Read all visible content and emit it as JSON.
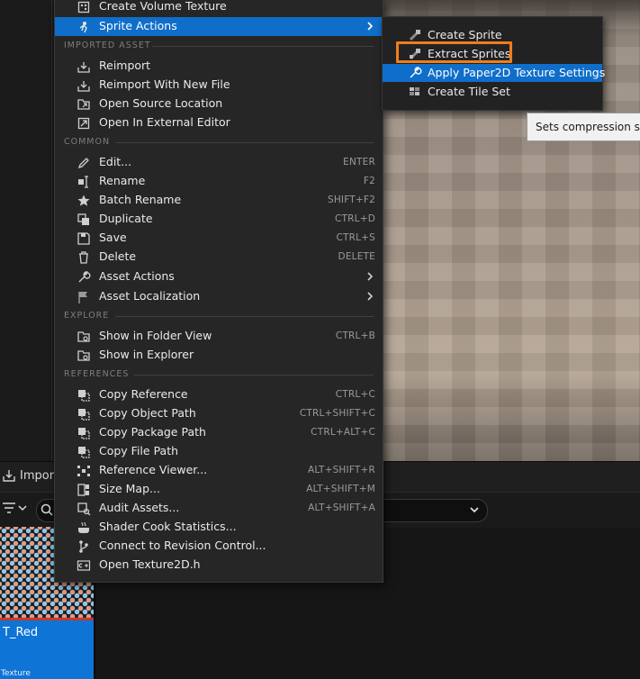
{
  "menu": {
    "top_items": [
      {
        "label": "Create Volume Texture",
        "icon": "volume-texture-icon"
      },
      {
        "label": "Sprite Actions",
        "icon": "sprite-actions-icon"
      }
    ],
    "sections": {
      "imported_asset": "IMPORTED ASSET",
      "common": "COMMON",
      "explore": "EXPLORE",
      "references": "REFERENCES"
    },
    "imported_asset_items": [
      {
        "label": "Reimport"
      },
      {
        "label": "Reimport With New File"
      },
      {
        "label": "Open Source Location"
      },
      {
        "label": "Open In External Editor"
      }
    ],
    "common_items": [
      {
        "label": "Edit...",
        "shortcut": "ENTER"
      },
      {
        "label": "Rename",
        "shortcut": "F2"
      },
      {
        "label": "Batch Rename",
        "shortcut": "SHIFT+F2"
      },
      {
        "label": "Duplicate",
        "shortcut": "CTRL+D"
      },
      {
        "label": "Save",
        "shortcut": "CTRL+S"
      },
      {
        "label": "Delete",
        "shortcut": "DELETE"
      },
      {
        "label": "Asset Actions"
      },
      {
        "label": "Asset Localization"
      }
    ],
    "explore_items": [
      {
        "label": "Show in Folder View",
        "shortcut": "CTRL+B"
      },
      {
        "label": "Show in Explorer"
      }
    ],
    "references_items": [
      {
        "label": "Copy Reference",
        "shortcut": "CTRL+C"
      },
      {
        "label": "Copy Object Path",
        "shortcut": "CTRL+SHIFT+C"
      },
      {
        "label": "Copy Package Path",
        "shortcut": "CTRL+ALT+C"
      },
      {
        "label": "Copy File Path"
      },
      {
        "label": "Reference Viewer...",
        "shortcut": "ALT+SHIFT+R"
      },
      {
        "label": "Size Map...",
        "shortcut": "ALT+SHIFT+M"
      },
      {
        "label": "Audit Assets...",
        "shortcut": "ALT+SHIFT+A"
      },
      {
        "label": "Shader Cook Statistics..."
      },
      {
        "label": "Connect to Revision Control..."
      },
      {
        "label": "Open Texture2D.h"
      }
    ]
  },
  "submenu": {
    "items": [
      {
        "label": "Create Sprite"
      },
      {
        "label": "Extract Sprites"
      },
      {
        "label": "Apply Paper2D Texture Settings"
      },
      {
        "label": "Create Tile Set"
      }
    ]
  },
  "tooltip": {
    "text": "Sets compression settings"
  },
  "content_browser": {
    "import_label": "Import",
    "asset_name": "T_Red",
    "asset_type": "Texture"
  },
  "colors": {
    "highlight": "#0f6ec9",
    "callout": "#f07d1a",
    "menu_bg": "#262626"
  }
}
